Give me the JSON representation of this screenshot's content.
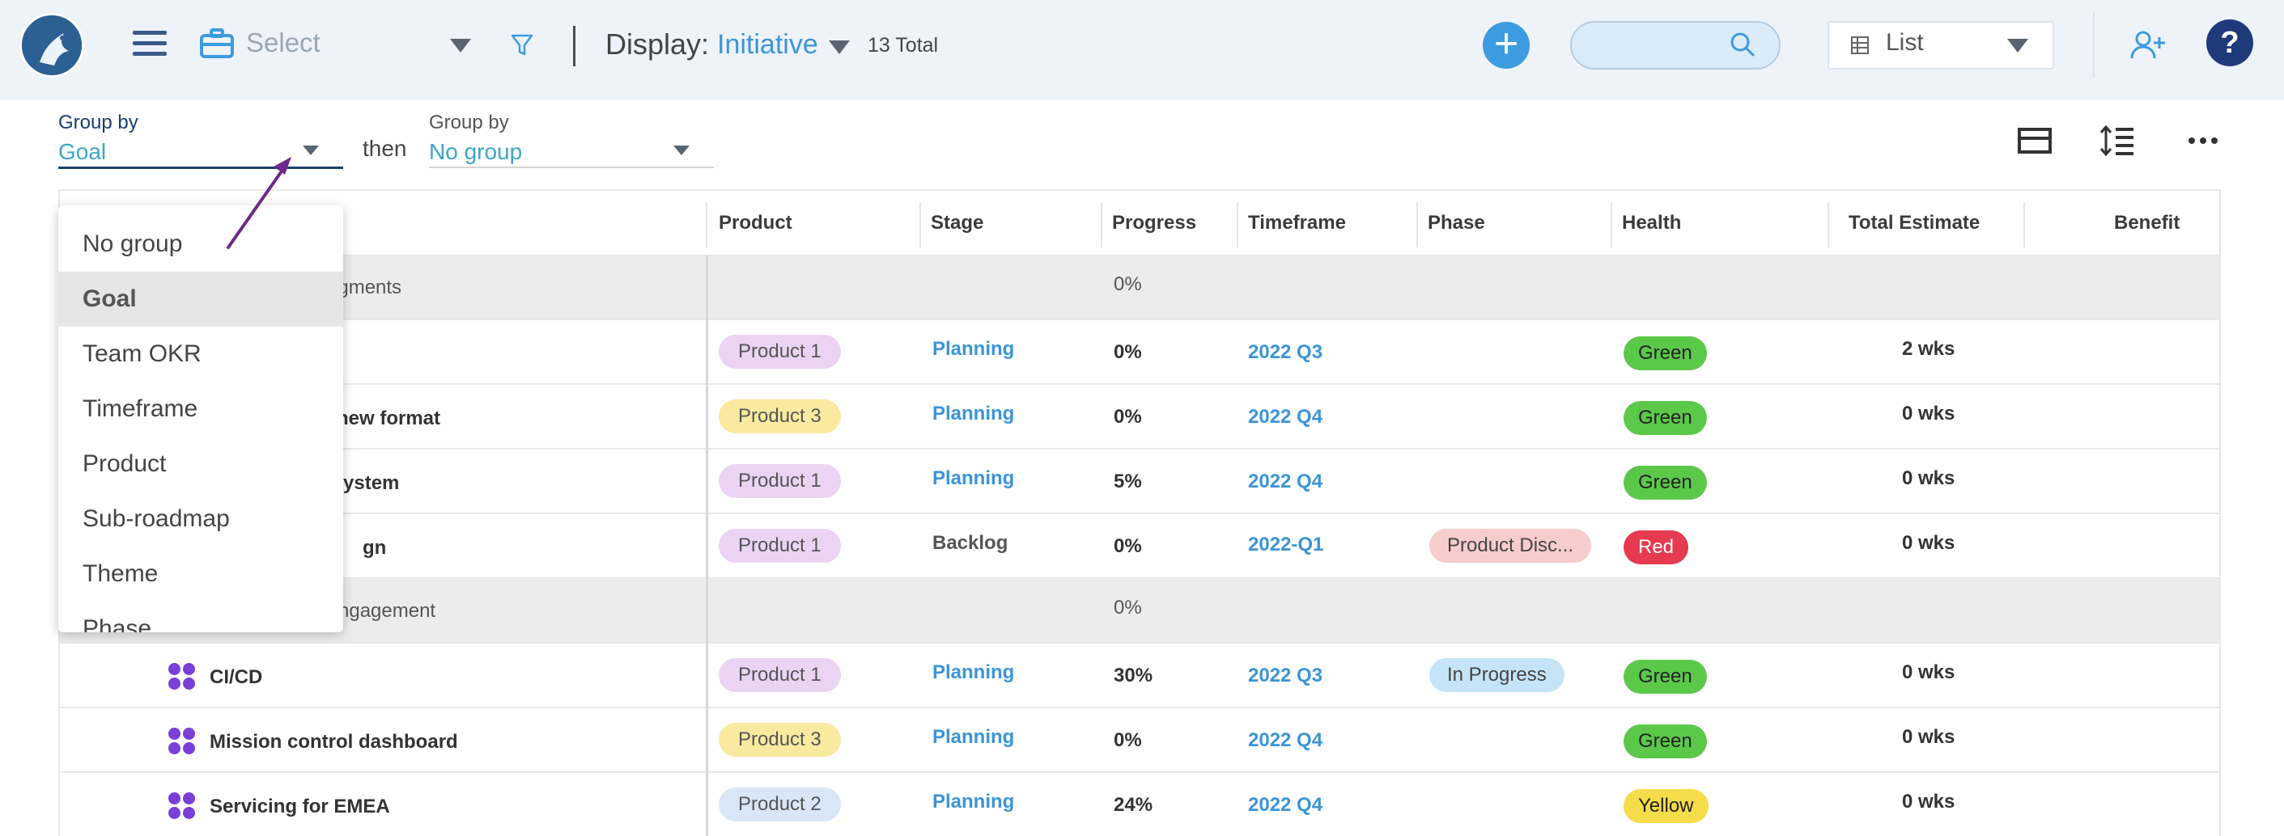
{
  "header": {
    "select_placeholder": "Select",
    "display_label": "Display:",
    "display_value": "Initiative",
    "total": "13 Total",
    "view_label": "List",
    "help_label": "?",
    "add_label": "+"
  },
  "grouping": {
    "group1_label": "Group by",
    "group1_value": "Goal",
    "then": "then",
    "group2_label": "Group by",
    "group2_value": "No group"
  },
  "dropdown": {
    "options": [
      "No group",
      "Goal",
      "Team OKR",
      "Timeframe",
      "Product",
      "Sub-roadmap",
      "Theme",
      "Phase"
    ],
    "selected": "Goal"
  },
  "table": {
    "columns": [
      "Product",
      "Stage",
      "Progress",
      "Timeframe",
      "Phase",
      "Health",
      "Total Estimate",
      "Benefit"
    ],
    "groups": [
      {
        "title": "egments",
        "progress": "0%"
      },
      {
        "title": "ngagement",
        "progress": "0%"
      }
    ],
    "rows": [
      {
        "name": "",
        "product": "Product 1",
        "stage": "Planning",
        "progress": "0%",
        "timeframe": "2022 Q3",
        "phase": "",
        "health": "Green",
        "estimate": "2 wks"
      },
      {
        "name": "new format",
        "product": "Product 3",
        "stage": "Planning",
        "progress": "0%",
        "timeframe": "2022 Q4",
        "phase": "",
        "health": "Green",
        "estimate": "0 wks"
      },
      {
        "name": "ystem",
        "product": "Product 1",
        "stage": "Planning",
        "progress": "5%",
        "timeframe": "2022 Q4",
        "phase": "",
        "health": "Green",
        "estimate": "0 wks"
      },
      {
        "name": "gn",
        "product": "Product 1",
        "stage": "Backlog",
        "progress": "0%",
        "timeframe": "2022-Q1",
        "phase": "Product Disc...",
        "health": "Red",
        "estimate": "0 wks"
      },
      {
        "name": "CI/CD",
        "product": "Product 1",
        "stage": "Planning",
        "progress": "30%",
        "timeframe": "2022 Q3",
        "phase": "In Progress",
        "health": "Green",
        "estimate": "0 wks"
      },
      {
        "name": "Mission control dashboard",
        "product": "Product 3",
        "stage": "Planning",
        "progress": "0%",
        "timeframe": "2022 Q4",
        "phase": "",
        "health": "Green",
        "estimate": "0 wks"
      },
      {
        "name": "Servicing for EMEA",
        "product": "Product 2",
        "stage": "Planning",
        "progress": "24%",
        "timeframe": "2022 Q4",
        "phase": "",
        "health": "Yellow",
        "estimate": "0 wks"
      }
    ]
  },
  "colors": {
    "accent": "#3b95d8",
    "health_green": "#5cc84a",
    "health_red": "#e63a50",
    "health_yellow": "#f5dc4a",
    "product_1": "#ebd4f3",
    "product_2": "#d8e6f6",
    "product_3": "#faeaa0",
    "phase_red": "#f6cccc",
    "phase_blue": "#c5e4f7",
    "arrow": "#6b2a8a"
  }
}
